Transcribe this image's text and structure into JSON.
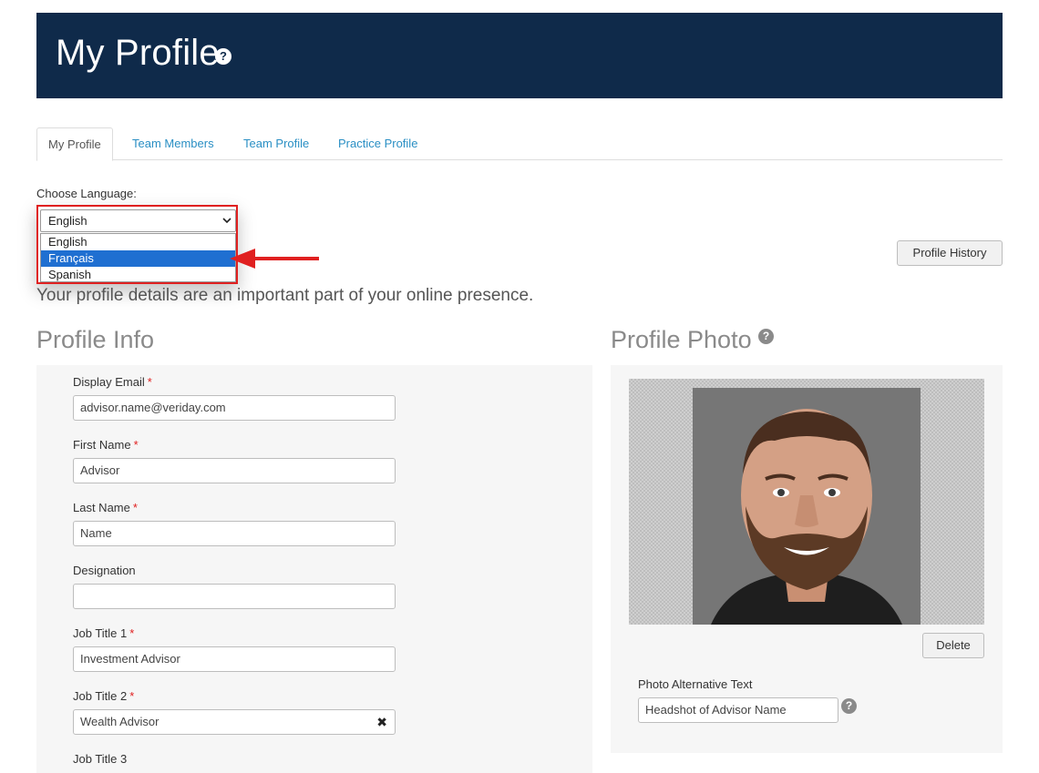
{
  "header": {
    "title": "My Profile",
    "help_icon": "question-circle-icon"
  },
  "tabs": [
    {
      "label": "My Profile",
      "active": true
    },
    {
      "label": "Team Members",
      "active": false
    },
    {
      "label": "Team Profile",
      "active": false
    },
    {
      "label": "Practice Profile",
      "active": false
    }
  ],
  "language": {
    "label": "Choose Language:",
    "selected": "English",
    "options": [
      "English",
      "Français",
      "Spanish"
    ],
    "highlighted": "Français"
  },
  "profile_history_label": "Profile History",
  "intro_text": "Your profile details are an important part of your online presence.",
  "profile_info": {
    "heading": "Profile Info",
    "fields": [
      {
        "label": "Display Email",
        "required": true,
        "value": "advisor.name@veriday.com"
      },
      {
        "label": "First Name",
        "required": true,
        "value": "Advisor"
      },
      {
        "label": "Last Name",
        "required": true,
        "value": "Name"
      },
      {
        "label": "Designation",
        "required": false,
        "value": ""
      },
      {
        "label": "Job Title 1",
        "required": true,
        "value": "Investment Advisor"
      },
      {
        "label": "Job Title 2",
        "required": true,
        "value": "Wealth Advisor"
      },
      {
        "label": "Job Title 3",
        "required": false,
        "value": ""
      }
    ],
    "required_mark": "*"
  },
  "profile_photo": {
    "heading": "Profile Photo",
    "delete_label": "Delete",
    "alt_label": "Photo Alternative Text",
    "alt_value": "Headshot of Advisor Name"
  },
  "colors": {
    "header_bg": "#0f2a4a",
    "link": "#2a8fc4",
    "highlight": "#e02020",
    "option_selected": "#1f6fd1"
  }
}
